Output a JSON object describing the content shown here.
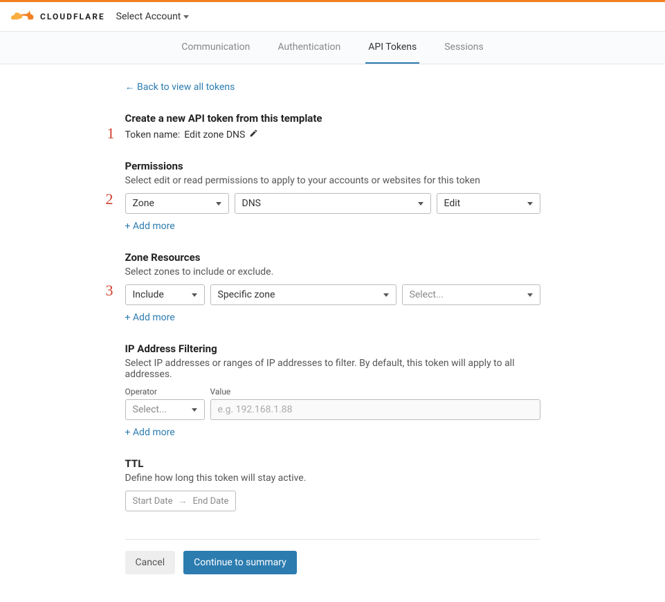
{
  "header": {
    "brand": "CLOUDFLARE",
    "account_selector_label": "Select Account"
  },
  "tabs": {
    "items": [
      "Communication",
      "Authentication",
      "API Tokens",
      "Sessions"
    ],
    "active_index": 2
  },
  "back_link": "Back to view all tokens",
  "page": {
    "title": "Create a new API token from this template",
    "token_name_label": "Token name:",
    "token_name_value": "Edit zone DNS"
  },
  "permissions": {
    "heading": "Permissions",
    "description": "Select edit or read permissions to apply to your accounts or websites for this token",
    "scope": "Zone",
    "resource": "DNS",
    "level": "Edit",
    "add_more": "+ Add more"
  },
  "zone_resources": {
    "heading": "Zone Resources",
    "description": "Select zones to include or exclude.",
    "mode": "Include",
    "scope": "Specific zone",
    "target_placeholder": "Select...",
    "add_more": "+ Add more"
  },
  "ip_filter": {
    "heading": "IP Address Filtering",
    "description": "Select IP addresses or ranges of IP addresses to filter. By default, this token will apply to all addresses.",
    "operator_label": "Operator",
    "operator_value": "Select...",
    "value_label": "Value",
    "value_placeholder": "e.g. 192.168.1.88",
    "add_more": "+ Add more"
  },
  "ttl": {
    "heading": "TTL",
    "description": "Define how long this token will stay active.",
    "start_label": "Start Date",
    "end_label": "End Date"
  },
  "footer": {
    "cancel": "Cancel",
    "continue": "Continue to summary"
  },
  "annotations": {
    "one": "1",
    "two": "2",
    "three": "3"
  }
}
